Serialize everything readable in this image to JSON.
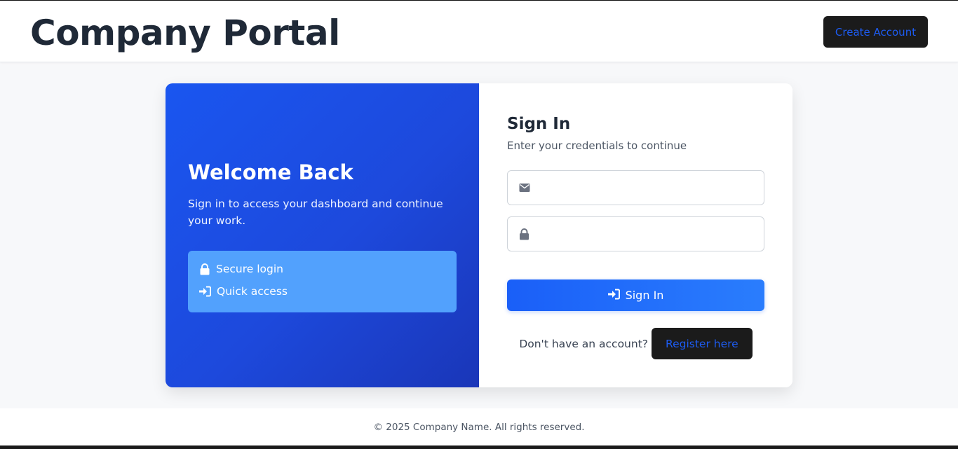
{
  "header": {
    "brand": "Company Portal",
    "create_account_label": "Create Account"
  },
  "welcome": {
    "title": "Welcome Back",
    "text": "Sign in to access your dashboard and continue your work.",
    "features": [
      {
        "icon": "lock-icon",
        "label": "Secure login"
      },
      {
        "icon": "sign-in-icon",
        "label": "Quick access"
      }
    ]
  },
  "signin": {
    "title": "Sign In",
    "subtitle": "Enter your credentials to continue",
    "email": {
      "icon": "envelope-icon",
      "value": "",
      "placeholder": ""
    },
    "password": {
      "icon": "lock-icon",
      "value": "",
      "placeholder": ""
    },
    "button_label": "Sign In",
    "register_prompt": "Don't have an account?",
    "register_label": "Register here"
  },
  "footer": {
    "text": "© 2025 Company Name. All rights reserved."
  },
  "colors": {
    "primary": "#1a5ff8",
    "dark_button": "#1b1b1b",
    "link_blue": "#1d5cf2",
    "feature_box": "#52a1fd"
  }
}
